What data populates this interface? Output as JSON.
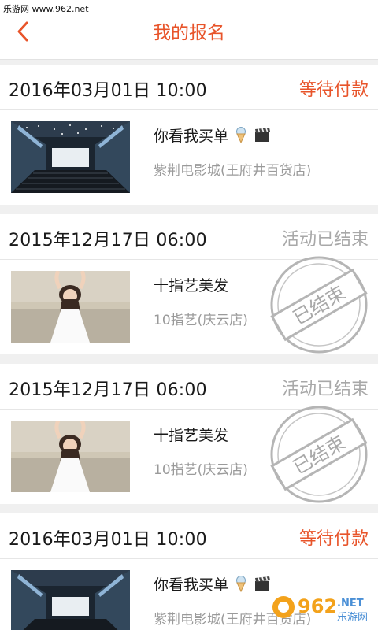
{
  "watermark_top": "乐游网 www.962.net",
  "header": {
    "title": "我的报名",
    "back_icon": "chevron-left-icon"
  },
  "stamp_text": "已结束",
  "orders": [
    {
      "date": "2016年03月01日 10:00",
      "status": "等待付款",
      "status_kind": "pending",
      "title": "你看我买单",
      "venue": "紫荆电影城(王府井百货店)",
      "thumb": "cinema",
      "emoji": true
    },
    {
      "date": "2015年12月17日 06:00",
      "status": "活动已结束",
      "status_kind": "ended",
      "title": "十指艺美发",
      "venue": "10指艺(庆云店)",
      "thumb": "girl",
      "emoji": false
    },
    {
      "date": "2015年12月17日 06:00",
      "status": "活动已结束",
      "status_kind": "ended",
      "title": "十指艺美发",
      "venue": "10指艺(庆云店)",
      "thumb": "girl",
      "emoji": false
    },
    {
      "date": "2016年03月01日 10:00",
      "status": "等待付款",
      "status_kind": "pending",
      "title": "你看我买单",
      "venue": "紫荆电影城(王府井百货店)",
      "thumb": "cinema",
      "emoji": true
    }
  ],
  "watermark_bottom": {
    "number": "962",
    "suffix": ".NET",
    "cn": "乐游网"
  },
  "colors": {
    "accent": "#e8542a",
    "ended": "#a8a8a8"
  }
}
